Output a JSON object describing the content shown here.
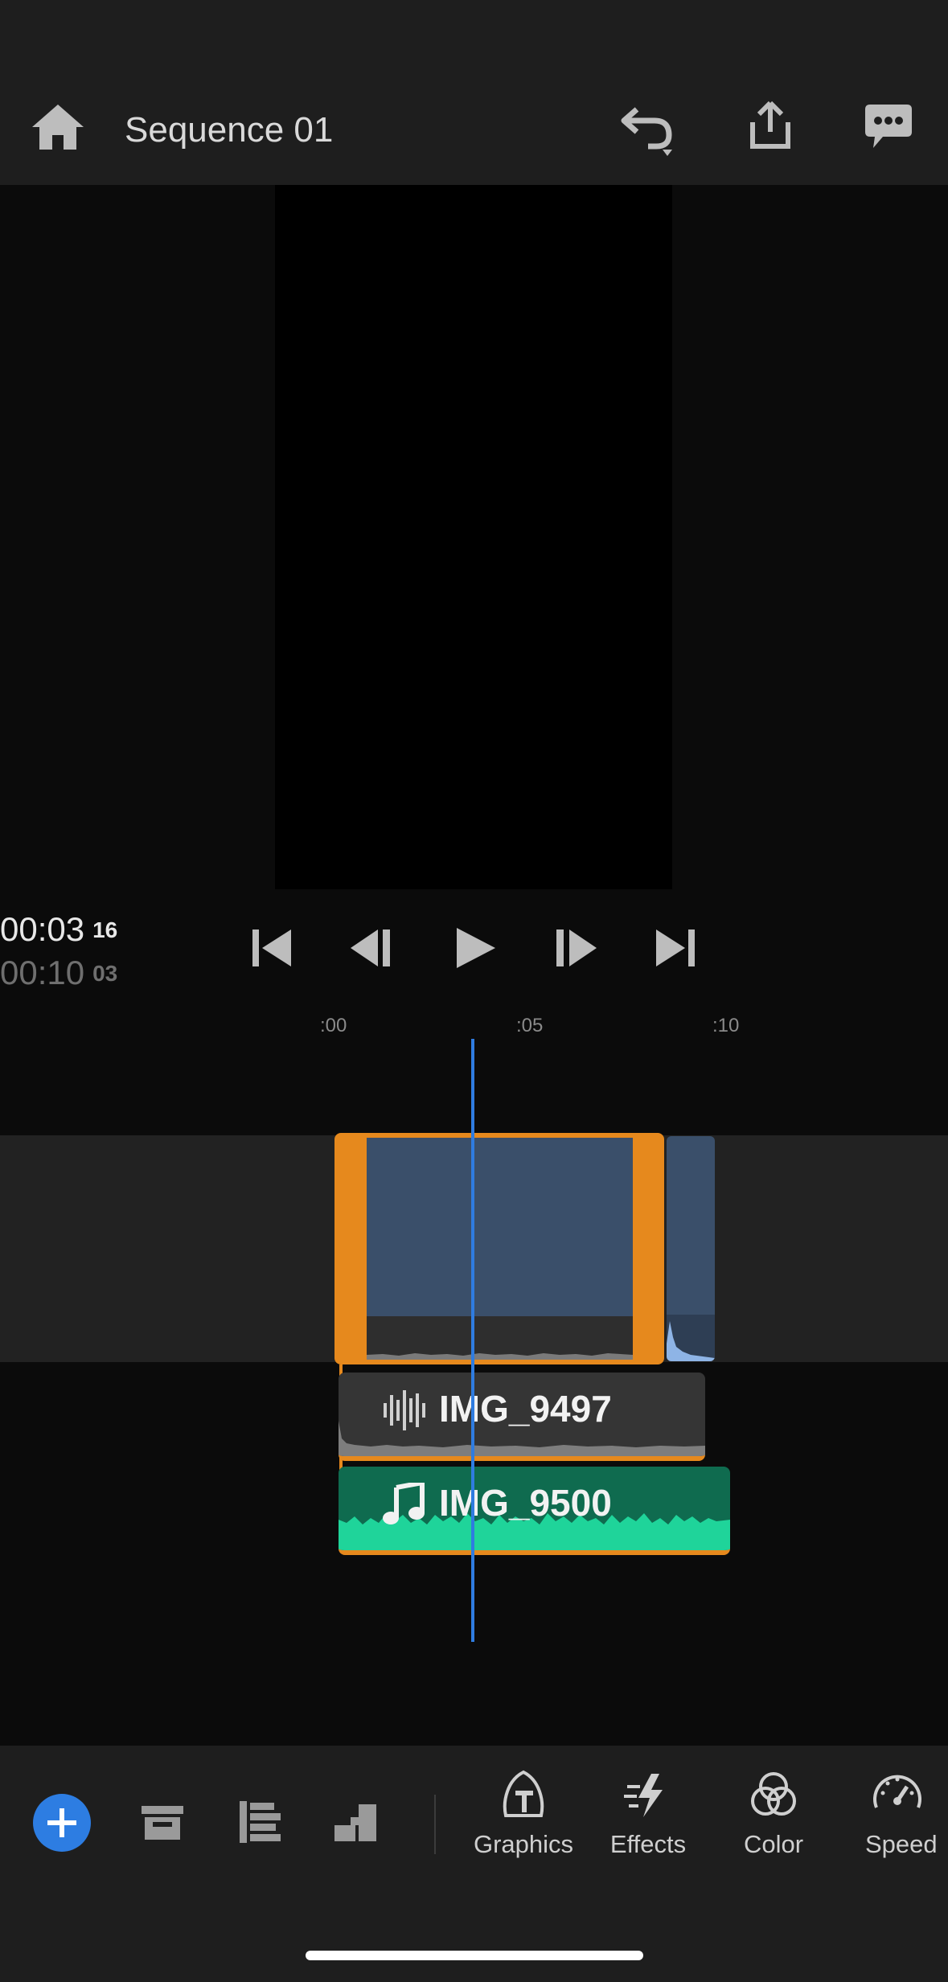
{
  "header": {
    "title": "Sequence 01",
    "icons": [
      "home-icon",
      "undo-icon",
      "share-icon",
      "comment-icon"
    ]
  },
  "playback": {
    "current_time": "00:03",
    "current_frames": "16",
    "total_time": "00:10",
    "total_frames": "03"
  },
  "ruler": {
    "ticks": [
      ":00",
      ":05",
      ":10"
    ]
  },
  "timeline": {
    "audio_clips": [
      {
        "name": "IMG_9497",
        "icon": "waveform-icon"
      },
      {
        "name": "IMG_9500",
        "icon": "music-note-icon"
      }
    ]
  },
  "toolbar": {
    "tools": [
      {
        "label": "Graphics",
        "icon": "graphics-icon"
      },
      {
        "label": "Effects",
        "icon": "effects-icon"
      },
      {
        "label": "Color",
        "icon": "color-icon"
      },
      {
        "label": "Speed",
        "icon": "speed-icon"
      }
    ]
  },
  "colors": {
    "accent": "#2d7de2",
    "clip_selected": "#e6891d",
    "video_clip": "#3a4f6a",
    "music_clip": "#0f6b4f",
    "music_wave": "#1fd49a"
  }
}
